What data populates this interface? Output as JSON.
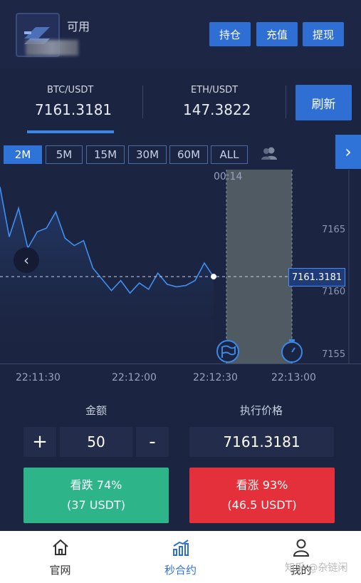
{
  "header": {
    "available_label": "可用",
    "buttons": {
      "hold": "持仓",
      "deposit": "充值",
      "withdraw": "提现"
    }
  },
  "pairs": [
    {
      "name": "BTC/USDT",
      "price": "7161.3181"
    },
    {
      "name": "ETH/USDT",
      "price": "147.3822"
    }
  ],
  "refresh_label": "刷新",
  "timeframes": [
    "2M",
    "5M",
    "15M",
    "30M",
    "60M",
    "ALL"
  ],
  "active_timeframe": "2M",
  "chart": {
    "countdown": "00:14",
    "current_price_tag": "7161.3181",
    "y_ticks": [
      "7165",
      "7160",
      "7155"
    ],
    "x_ticks": [
      "22:11:30",
      "22:12:00",
      "22:12:30",
      "22:13:00"
    ],
    "colors": {
      "line": "#3f8ff0",
      "shade": "#505a63",
      "accent": "#2f73d8"
    }
  },
  "chart_data": {
    "type": "line",
    "x": [
      "22:11:22",
      "22:11:25",
      "22:11:28",
      "22:11:31",
      "22:11:34",
      "22:11:37",
      "22:11:40",
      "22:11:43",
      "22:11:46",
      "22:11:49",
      "22:11:52",
      "22:11:55",
      "22:11:58",
      "22:12:01",
      "22:12:04",
      "22:12:07",
      "22:12:10",
      "22:12:13",
      "22:12:16",
      "22:12:19",
      "22:12:22",
      "22:12:25",
      "22:12:28",
      "22:12:31"
    ],
    "y": [
      7168.5,
      7164.5,
      7166.8,
      7163.6,
      7164.9,
      7165.2,
      7166.5,
      7164.4,
      7163.8,
      7164.2,
      7162.0,
      7161.1,
      7160.2,
      7161.0,
      7160.0,
      7160.8,
      7160.3,
      7161.6,
      7160.7,
      7160.5,
      7160.6,
      7161.0,
      7162.4,
      7161.3
    ],
    "ylim": [
      7154.3,
      7170.0
    ],
    "yticks": [
      7155,
      7160,
      7165
    ],
    "xticks": [
      "22:11:30",
      "22:12:00",
      "22:12:30",
      "22:13:00"
    ],
    "last_price": 7161.3181
  },
  "form": {
    "amount_label": "金额",
    "amount_value": "50",
    "minus": "-",
    "plus": "+",
    "exec_price_label": "执行价格",
    "exec_price_value": "7161.3181"
  },
  "trade": {
    "down_label": "看跌 74%",
    "down_amount": "(37 USDT)",
    "up_label": "看涨 93%",
    "up_amount": "(46.5 USDT)"
  },
  "tabs": [
    {
      "label": "官网",
      "icon": "home-icon"
    },
    {
      "label": "秒合约",
      "icon": "chart-icon"
    },
    {
      "label": "我的",
      "icon": "user-icon"
    }
  ],
  "watermark": "知乎 @杂链闲"
}
